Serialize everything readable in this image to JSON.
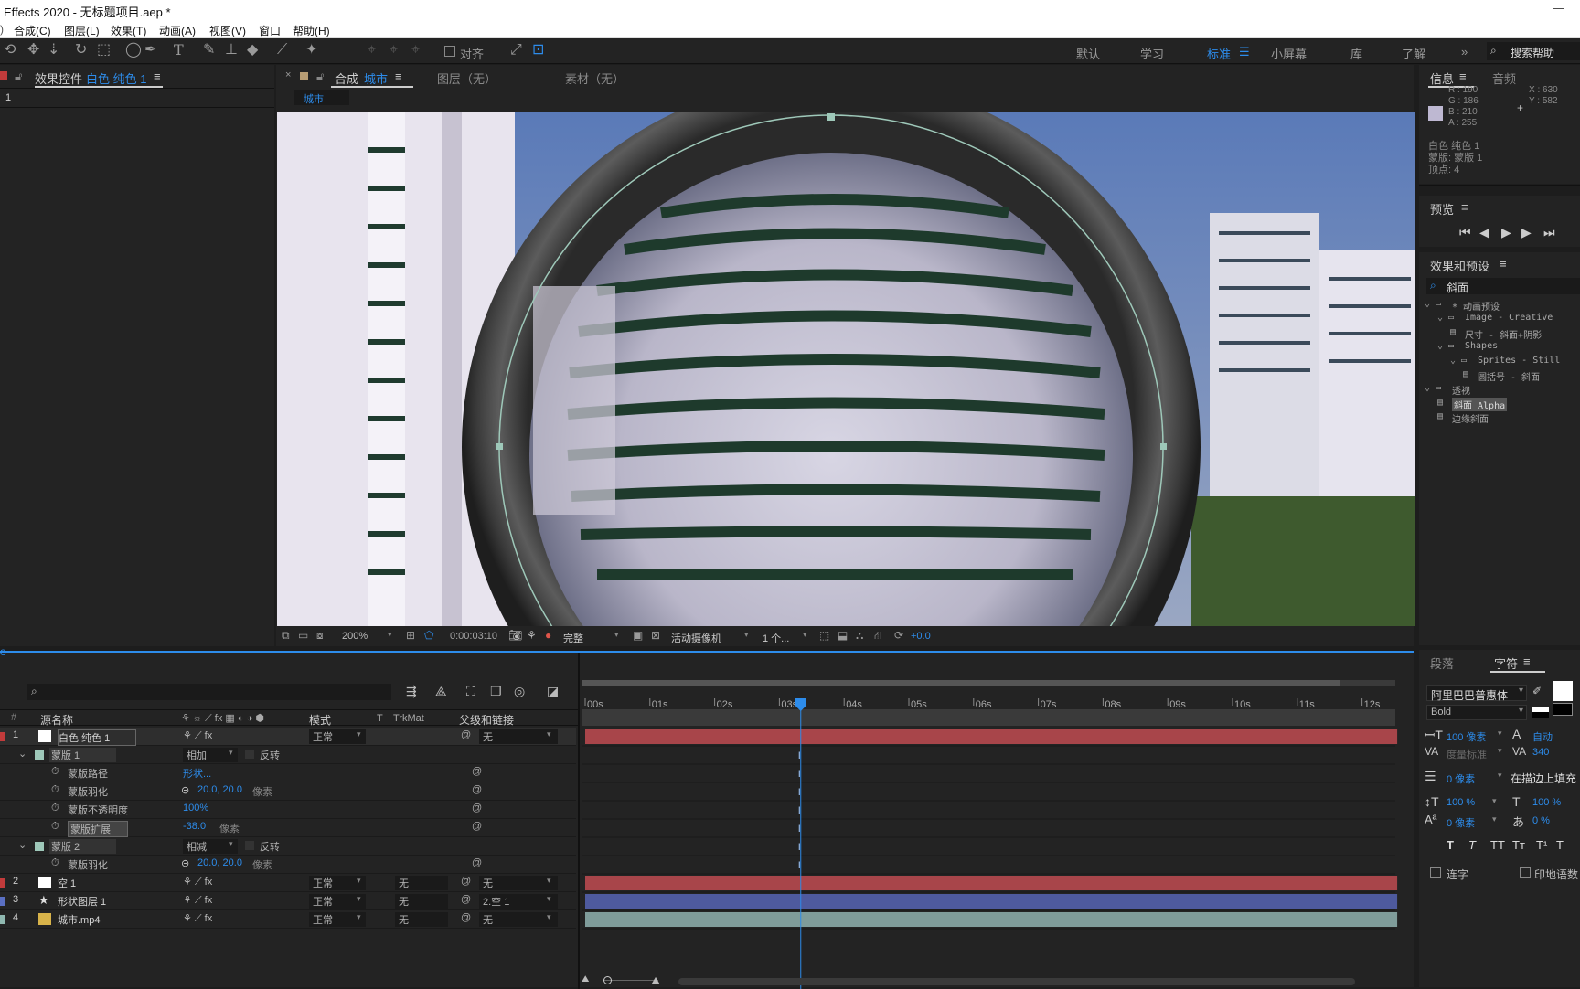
{
  "titlebar": {
    "title": "Effects 2020 - 无标题项目.aep *",
    "minimize": "—"
  },
  "menu": [
    "合成(C)",
    "图层(L)",
    "效果(T)",
    "动画(A)",
    "视图(V)",
    "窗口",
    "帮助(H)"
  ],
  "toolbar": {
    "align_label": "对齐",
    "workspaces": [
      "默认",
      "学习",
      "标准",
      "小屏幕",
      "库",
      "了解"
    ],
    "active_workspace": "标准",
    "search_help": "搜索帮助"
  },
  "effects_panel": {
    "tab_label": "效果控件",
    "layer_name": "白色 纯色 1",
    "crumb": "1"
  },
  "comp_panel": {
    "tab_label": "合成",
    "comp_name": "城市",
    "layer_tab": "图层（无）",
    "footage_tab": "素材（无）",
    "breadcrumb": "城市",
    "zoom": "200%",
    "timecode": "0:00:03:10",
    "resolution": "完整",
    "camera": "活动摄像机",
    "views": "1 个...",
    "exposure": "+0.0"
  },
  "info_panel": {
    "tab": "信息",
    "tab2": "音频",
    "r": "R : 190",
    "g": "G : 186",
    "b": "B : 210",
    "a": "A : 255",
    "x": "X : 630",
    "y": "Y : 582",
    "line1": "白色 纯色 1",
    "line2": "蒙版: 蒙版 1",
    "line3": "顶点: 4",
    "sample_color": "#beb8d2"
  },
  "preview_panel": {
    "tab": "预览"
  },
  "effects_presets": {
    "tab": "效果和预设",
    "search": "斜面",
    "tree": [
      {
        "label": "* 动画预设",
        "indent": 0,
        "kind": "folder"
      },
      {
        "label": "Image - Creative",
        "indent": 1,
        "kind": "folder"
      },
      {
        "label": "尺寸 - 斜面+阴影",
        "indent": 2,
        "kind": "item"
      },
      {
        "label": "Shapes",
        "indent": 1,
        "kind": "folder"
      },
      {
        "label": "Sprites - Still",
        "indent": 2,
        "kind": "folder"
      },
      {
        "label": "圆括号 - 斜面",
        "indent": 3,
        "kind": "item"
      },
      {
        "label": "透视",
        "indent": 0,
        "kind": "folder"
      },
      {
        "label": "斜面 Alpha",
        "indent": 1,
        "kind": "item",
        "selected": true
      },
      {
        "label": "边缘斜面",
        "indent": 1,
        "kind": "item"
      }
    ]
  },
  "character_panel": {
    "tab1": "段落",
    "tab2": "字符",
    "font": "阿里巴巴普惠体",
    "style": "Bold",
    "size": "100 像素",
    "leading": "自动",
    "kerning": "度量标准",
    "tracking": "340",
    "stroke": "0 像素",
    "stroke_mode": "在描边上填充",
    "vscale": "100 %",
    "hscale": "100 %",
    "baseline": "0 像素",
    "tsume": "0 %",
    "styles": [
      "T",
      "T",
      "TT",
      "Tт",
      "T¹",
      "T"
    ],
    "ligatures": "连字",
    "hindi": "印地语数"
  },
  "timeline": {
    "headers": {
      "num": "#",
      "source": "源名称",
      "mode": "模式",
      "t": "T",
      "trkmat": "TrkMat",
      "parent": "父级和链接"
    },
    "ruler": [
      "00s",
      "01s",
      "02s",
      "03s",
      "04s",
      "05s",
      "06s",
      "07s",
      "08s",
      "09s",
      "10s",
      "11s",
      "12s"
    ],
    "playhead_seconds": 3.33,
    "duration_seconds": 12.6,
    "rows": [
      {
        "num": "1",
        "name": "白色 纯色 1",
        "mode": "正常",
        "trkmat": "",
        "parent": "无",
        "kind": "layer",
        "label_color": "#c23b3b",
        "icon": "solid-white",
        "bar_color": "#a8454a"
      },
      {
        "kind": "mask",
        "name": "蒙版 1",
        "blend": "相加",
        "invert": "反转",
        "swatch": "#9ec8b9"
      },
      {
        "kind": "prop",
        "name": "蒙版路径",
        "value": "形状..."
      },
      {
        "kind": "prop",
        "name": "蒙版羽化",
        "value": "20.0, 20.0",
        "unit": "像素",
        "link": true
      },
      {
        "kind": "prop",
        "name": "蒙版不透明度",
        "value": "100%"
      },
      {
        "kind": "prop",
        "name": "蒙版扩展",
        "value": "-38.0",
        "unit": "像素",
        "highlight": true
      },
      {
        "kind": "mask",
        "name": "蒙版 2",
        "blend": "相减",
        "invert": "反转",
        "swatch": "#9ec8b9"
      },
      {
        "kind": "prop",
        "name": "蒙版羽化",
        "value": "20.0, 20.0",
        "unit": "像素",
        "link": true
      },
      {
        "num": "2",
        "name": "空 1",
        "mode": "正常",
        "trkmat": "无",
        "parent": "无",
        "kind": "layer",
        "label_color": "#c23b3b",
        "icon": "solid-white",
        "bar_color": "#a8454a"
      },
      {
        "num": "3",
        "name": "形状图层 1",
        "mode": "正常",
        "trkmat": "无",
        "parent": "2.空 1",
        "kind": "layer",
        "label_color": "#5a6fc2",
        "icon": "star",
        "bar_color": "#4e5a9e"
      },
      {
        "num": "4",
        "name": "城市.mp4",
        "mode": "正常",
        "trkmat": "无",
        "parent": "无",
        "kind": "layer",
        "label_color": "#8fb8b0",
        "icon": "footage",
        "bar_color": "#7f9c9a"
      }
    ]
  }
}
